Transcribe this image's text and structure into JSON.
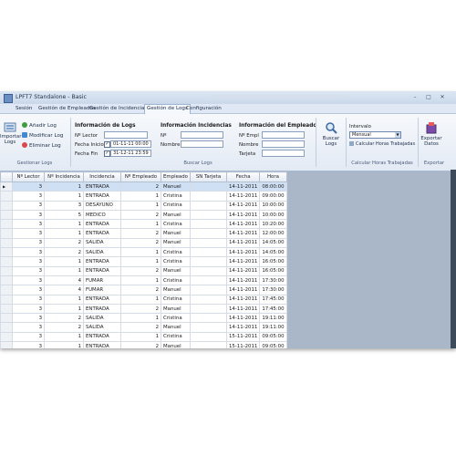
{
  "window": {
    "title": "LPFT7 Standalone - Basic"
  },
  "menu": {
    "tabs": [
      {
        "label": "Sesión"
      },
      {
        "label": "Gestión de Empleados"
      },
      {
        "label": "Gestión de Incidencias"
      },
      {
        "label": "Gestión de Logs"
      },
      {
        "label": "Configuración"
      }
    ],
    "active_tab": "Gestión de Logs"
  },
  "ribbon": {
    "gestionar": {
      "import_label_1": "Importar",
      "import_label_2": "Logs",
      "add": "Añadir Log",
      "modify": "Modificar Log",
      "delete": "Eliminar Log",
      "group_label": "Gestionar Logs"
    },
    "info_logs": {
      "heading": "Información de Logs",
      "lector_label": "Nº Lector",
      "lector_value": "",
      "fecha_inicio_label": "Fecha Inicio",
      "fecha_inicio_value": "01-11-11 00:00",
      "fecha_fin_label": "Fecha Fin",
      "fecha_fin_value": "31-12-11 23:59"
    },
    "info_incidencias": {
      "heading": "Información Incidencias",
      "num_label": "Nº",
      "nombre_label": "Nombre"
    },
    "info_empleado": {
      "heading": "Información del Empleado",
      "num_label": "Nº Empl",
      "nombre_label": "Nombre",
      "tarjeta_label": "Tarjeta"
    },
    "buscar": {
      "label_1": "Buscar",
      "label_2": "Logs",
      "group_label": "Buscar Logs"
    },
    "intervalo": {
      "heading": "Intervalo",
      "selected": "Mensual",
      "calc_button": "Calcular Horas Trabajadas",
      "group_label": "Calcular Horas Trabajadas"
    },
    "exportar": {
      "label_1": "Exportar",
      "label_2": "Datos",
      "group_label": "Exportar"
    }
  },
  "grid": {
    "columns": [
      "Nº Lector",
      "Nº Incidencia",
      "Incidencia",
      "Nº Empleado",
      "Empleado",
      "SN Tarjeta",
      "Fecha",
      "Hora"
    ],
    "rows": [
      [
        "3",
        "1",
        "ENTRADA",
        "2",
        "Manuel",
        "",
        "14-11-2011",
        "08:00:00"
      ],
      [
        "3",
        "1",
        "ENTRADA",
        "1",
        "Cristina",
        "",
        "14-11-2011",
        "09:00:00"
      ],
      [
        "3",
        "3",
        "DESAYUNO",
        "1",
        "Cristina",
        "",
        "14-11-2011",
        "10:00:00"
      ],
      [
        "3",
        "5",
        "MEDICO",
        "2",
        "Manuel",
        "",
        "14-11-2011",
        "10:00:00"
      ],
      [
        "3",
        "1",
        "ENTRADA",
        "1",
        "Cristina",
        "",
        "14-11-2011",
        "10:20:00"
      ],
      [
        "3",
        "1",
        "ENTRADA",
        "2",
        "Manuel",
        "",
        "14-11-2011",
        "12:00:00"
      ],
      [
        "3",
        "2",
        "SALIDA",
        "2",
        "Manuel",
        "",
        "14-11-2011",
        "14:05:00"
      ],
      [
        "3",
        "2",
        "SALIDA",
        "1",
        "Cristina",
        "",
        "14-11-2011",
        "14:05:00"
      ],
      [
        "3",
        "1",
        "ENTRADA",
        "1",
        "Cristina",
        "",
        "14-11-2011",
        "16:05:00"
      ],
      [
        "3",
        "1",
        "ENTRADA",
        "2",
        "Manuel",
        "",
        "14-11-2011",
        "16:05:00"
      ],
      [
        "3",
        "4",
        "FUMAR",
        "1",
        "Cristina",
        "",
        "14-11-2011",
        "17:30:00"
      ],
      [
        "3",
        "4",
        "FUMAR",
        "2",
        "Manuel",
        "",
        "14-11-2011",
        "17:30:00"
      ],
      [
        "3",
        "1",
        "ENTRADA",
        "1",
        "Cristina",
        "",
        "14-11-2011",
        "17:45:00"
      ],
      [
        "3",
        "1",
        "ENTRADA",
        "2",
        "Manuel",
        "",
        "14-11-2011",
        "17:45:00"
      ],
      [
        "3",
        "2",
        "SALIDA",
        "1",
        "Cristina",
        "",
        "14-11-2011",
        "19:11:00"
      ],
      [
        "3",
        "2",
        "SALIDA",
        "2",
        "Manuel",
        "",
        "14-11-2011",
        "19:11:00"
      ],
      [
        "3",
        "1",
        "ENTRADA",
        "1",
        "Cristina",
        "",
        "15-11-2011",
        "09:05:00"
      ],
      [
        "3",
        "1",
        "ENTRADA",
        "2",
        "Manuel",
        "",
        "15-11-2011",
        "09:05:00"
      ],
      [
        "3",
        "3",
        "DESAYUNO",
        "1",
        "Cristina",
        "",
        "15-11-2011",
        "10:00:00"
      ]
    ]
  },
  "colors": {
    "selected_row": "#cfe0f5",
    "ribbon_bg": "#e3eaf4",
    "grid_bg": "#a9b7c8"
  }
}
